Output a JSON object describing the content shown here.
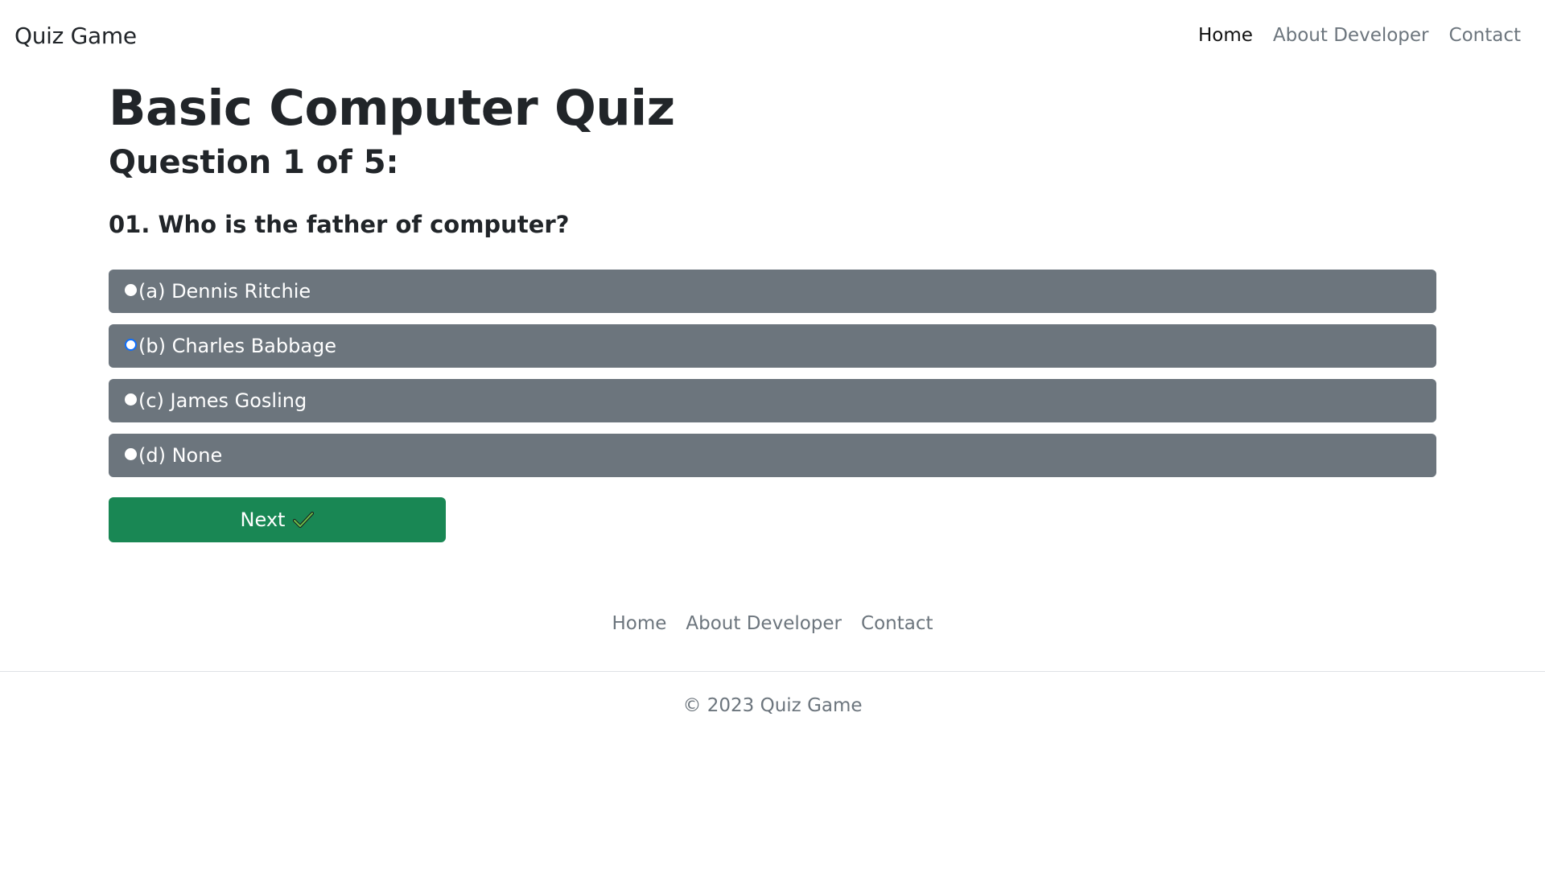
{
  "navbar": {
    "brand": "Quiz Game",
    "links": [
      "Home",
      "About Developer",
      "Contact"
    ],
    "active": "Home"
  },
  "quiz": {
    "title": "Basic Computer Quiz",
    "question_count": "Question 1 of 5:",
    "question": "01. Who is the father of computer?",
    "options": [
      {
        "label": "(a) Dennis Ritchie",
        "selected": false
      },
      {
        "label": "(b) Charles Babbage",
        "selected": true
      },
      {
        "label": "(c) James Gosling",
        "selected": false
      },
      {
        "label": "(d) None",
        "selected": false
      }
    ],
    "next_label": "Next",
    "next_icon": "check-icon"
  },
  "footer": {
    "links": [
      "Home",
      "About Developer",
      "Contact"
    ],
    "copyright": "© 2023 Quiz Game"
  },
  "colors": {
    "option_bg": "#6c757d",
    "next_bg": "#198754",
    "radio_accent": "#0d6efd"
  }
}
